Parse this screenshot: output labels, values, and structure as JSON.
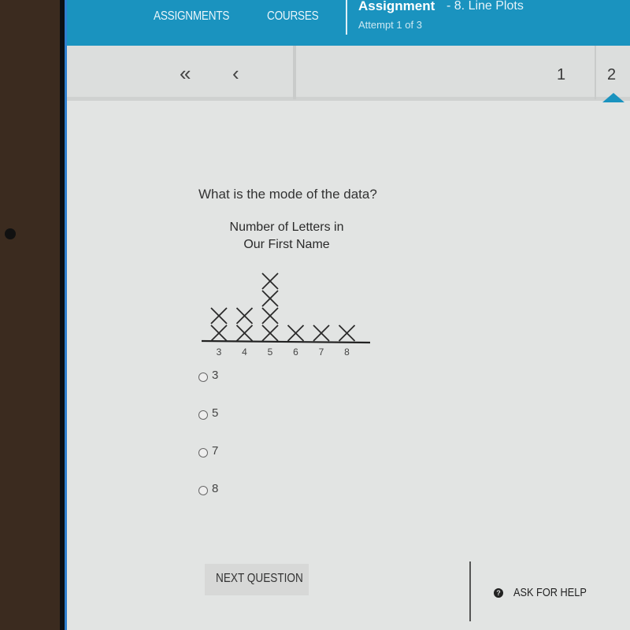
{
  "header": {
    "nav": [
      "ASSIGNMENTS",
      "COURSES"
    ],
    "title": "Assignment",
    "subtitle": "- 8. Line Plots",
    "attempt": "Attempt 1 of 3",
    "accent_color": "#1a93bf"
  },
  "pager": {
    "first_icon": "«",
    "prev_icon": "‹",
    "pages": [
      "1",
      "2"
    ],
    "current_page": "2"
  },
  "question": {
    "text": "What is the mode of the data?",
    "options": [
      "3",
      "5",
      "7",
      "8"
    ]
  },
  "chart_data": {
    "type": "line-plot",
    "title": "Number of Letters in Our First Name",
    "title_lines": [
      "Number of Letters in",
      "Our First Name"
    ],
    "categories": [
      "3",
      "4",
      "5",
      "6",
      "7",
      "8"
    ],
    "values": [
      2,
      2,
      4,
      1,
      1,
      1
    ],
    "marker": "X",
    "xlabel": "",
    "ylabel": ""
  },
  "footer": {
    "next_label": "NEXT QUESTION",
    "help_icon": "?",
    "help_label": "ASK FOR HELP"
  }
}
